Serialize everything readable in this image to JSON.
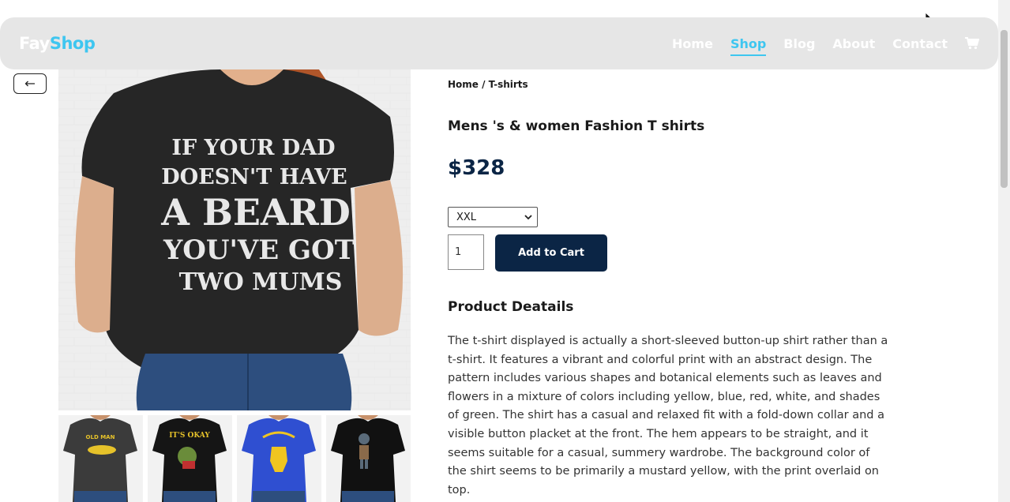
{
  "brand": {
    "part1": "Fay",
    "part2": "Shop"
  },
  "nav": {
    "items": [
      "Home",
      "Shop",
      "Blog",
      "About",
      "Contact"
    ],
    "active": "Shop"
  },
  "colors": {
    "accent": "#3ec6f0",
    "navy": "#0b2545",
    "navbar_bg": "#e6e6e6"
  },
  "back_button": {
    "icon": "arrow-left-icon"
  },
  "hero_image": {
    "shirt_text": [
      "IF YOUR DAD",
      "DOESN'T HAVE",
      "A BEARD",
      "YOU'VE GOT",
      "TWO MUMS"
    ]
  },
  "thumbnails": [
    {
      "shirt_color": "#3b3b3b",
      "print": "OLD MAN"
    },
    {
      "shirt_color": "#151515",
      "print": "IT'S OKAY"
    },
    {
      "shirt_color": "#2f4fd1",
      "print": "fist"
    },
    {
      "shirt_color": "#111111",
      "print": "figure"
    }
  ],
  "breadcrumb": "Home / T-shirts",
  "product": {
    "title": "Mens 's & women Fashion T shirts",
    "price": "$328",
    "size_selected": "XXL",
    "quantity": "1",
    "add_to_cart_label": "Add to Cart"
  },
  "details": {
    "heading": "Product Deatails",
    "description": "The t-shirt displayed is actually a short-sleeved button-up shirt rather than a t-shirt. It features a vibrant and colorful print with an abstract design. The pattern includes various shapes and botanical elements such as leaves and flowers in a mixture of colors including yellow, blue, red, white, and shades of green. The shirt has a casual and relaxed fit with a fold-down collar and a visible button placket at the front. The hem appears to be straight, and it seems suitable for a casual, summery wardrobe. The background color of the shirt seems to be primarily a mustard yellow, with the print overlaid on top."
  }
}
